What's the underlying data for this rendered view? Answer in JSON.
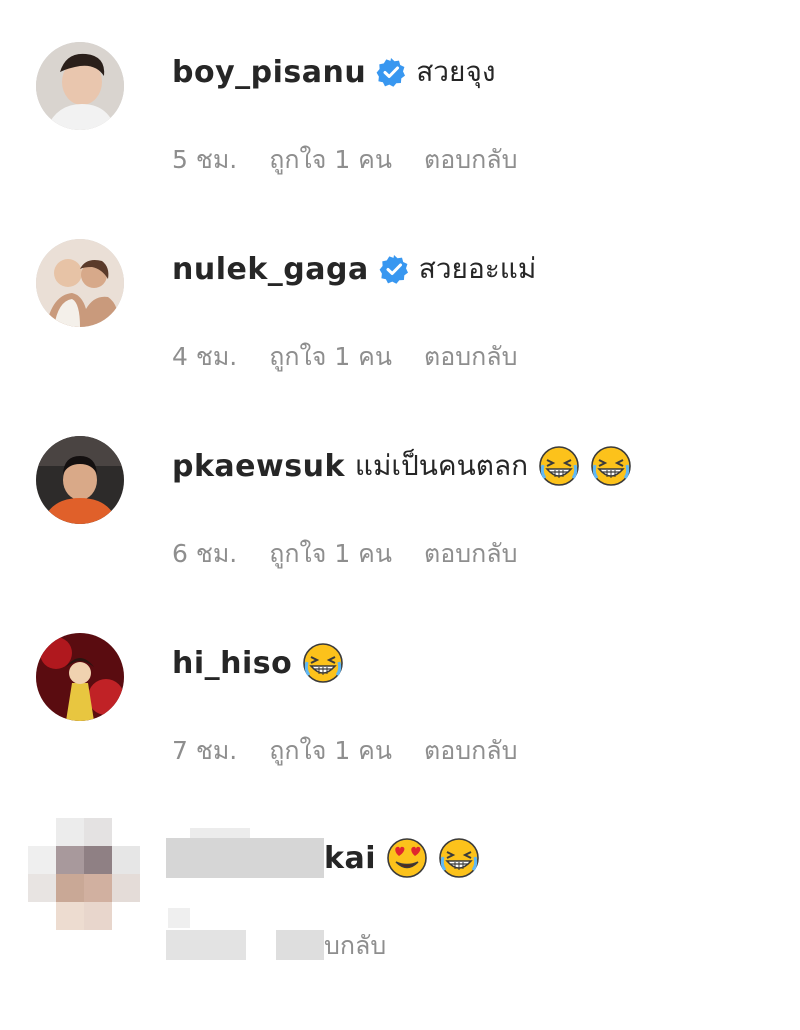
{
  "comments": [
    {
      "username": "boy_pisanu",
      "verified": true,
      "text": "สวยจุง",
      "emojis": [],
      "time": "5 ชม.",
      "likes": "ถูกใจ 1 คน",
      "reply": "ตอบกลับ"
    },
    {
      "username": "nulek_gaga",
      "verified": true,
      "text": "สวยอะแม่",
      "emojis": [],
      "time": "4 ชม.",
      "likes": "ถูกใจ 1 คน",
      "reply": "ตอบกลับ"
    },
    {
      "username": "pkaewsuk",
      "verified": false,
      "text": "แม่เป็นคนตลก",
      "emojis": [
        "grinning-squinting-face",
        "grinning-squinting-face"
      ],
      "time": "6 ชม.",
      "likes": "ถูกใจ 1 คน",
      "reply": "ตอบกลับ"
    },
    {
      "username": "hi_hiso",
      "verified": false,
      "text": "",
      "emojis": [
        "grinning-squinting-face"
      ],
      "time": "7 ชม.",
      "likes": "ถูกใจ 1 คน",
      "reply": "ตอบกลับ"
    }
  ],
  "blurred_comment": {
    "username_visible": "kai",
    "emojis": [
      "heart-eyes-face",
      "grinning-squinting-face"
    ],
    "reply_visible": "บกลับ"
  },
  "colors": {
    "username": "#262626",
    "meta": "#8e8e8e",
    "verified_badge": "#3897f0",
    "emoji_face": "#fcc21b"
  }
}
